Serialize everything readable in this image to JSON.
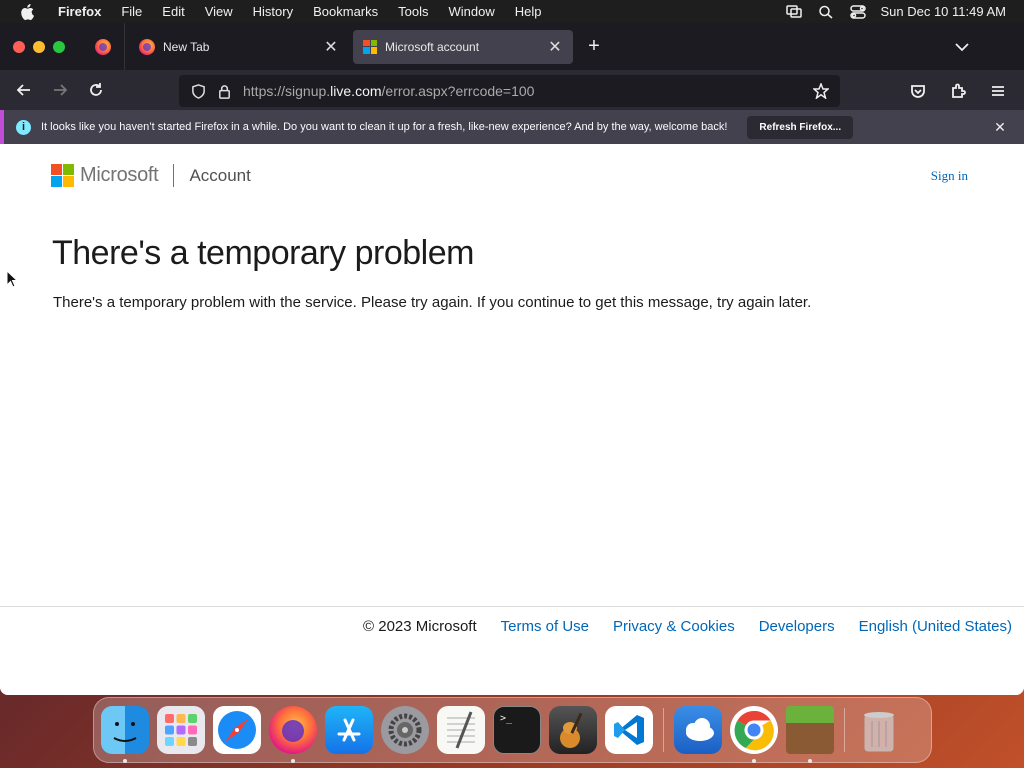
{
  "menubar": {
    "app_name": "Firefox",
    "menus": [
      "File",
      "Edit",
      "View",
      "History",
      "Bookmarks",
      "Tools",
      "Window",
      "Help"
    ],
    "clock": "Sun Dec 10  11:49 AM"
  },
  "tabs": [
    {
      "title": "New Tab",
      "icon": "firefox-icon"
    },
    {
      "title": "Microsoft account",
      "icon": "microsoft-icon",
      "active": true
    }
  ],
  "urlbar": {
    "prefix": "https://signup.",
    "host": "live.com",
    "suffix": "/error.aspx?errcode=100"
  },
  "notification": {
    "message": "It looks like you haven’t started Firefox in a while. Do you want to clean it up for a fresh, like-new experience? And by the way, welcome back!",
    "button_label": "Refresh Firefox..."
  },
  "page": {
    "brand": "Microsoft",
    "section": "Account",
    "sign_in": "Sign in",
    "title": "There's a temporary problem",
    "message": "There's a temporary problem with the service. Please try again. If you continue to get this message, try again later."
  },
  "footer": {
    "copyright": "© 2023 Microsoft",
    "links": [
      "Terms of Use",
      "Privacy & Cookies",
      "Developers",
      "English (United States)"
    ]
  },
  "colors": {
    "link_blue": "#0067b8",
    "notification_accent": "#c24dd8"
  },
  "dock": {
    "apps": [
      "Finder",
      "Launchpad",
      "Safari",
      "Firefox",
      "App Store",
      "System Preferences",
      "TextEdit",
      "Terminal",
      "GarageBand",
      "Visual Studio Code",
      "Weather",
      "Google Chrome",
      "Minecraft",
      "Trash"
    ]
  }
}
